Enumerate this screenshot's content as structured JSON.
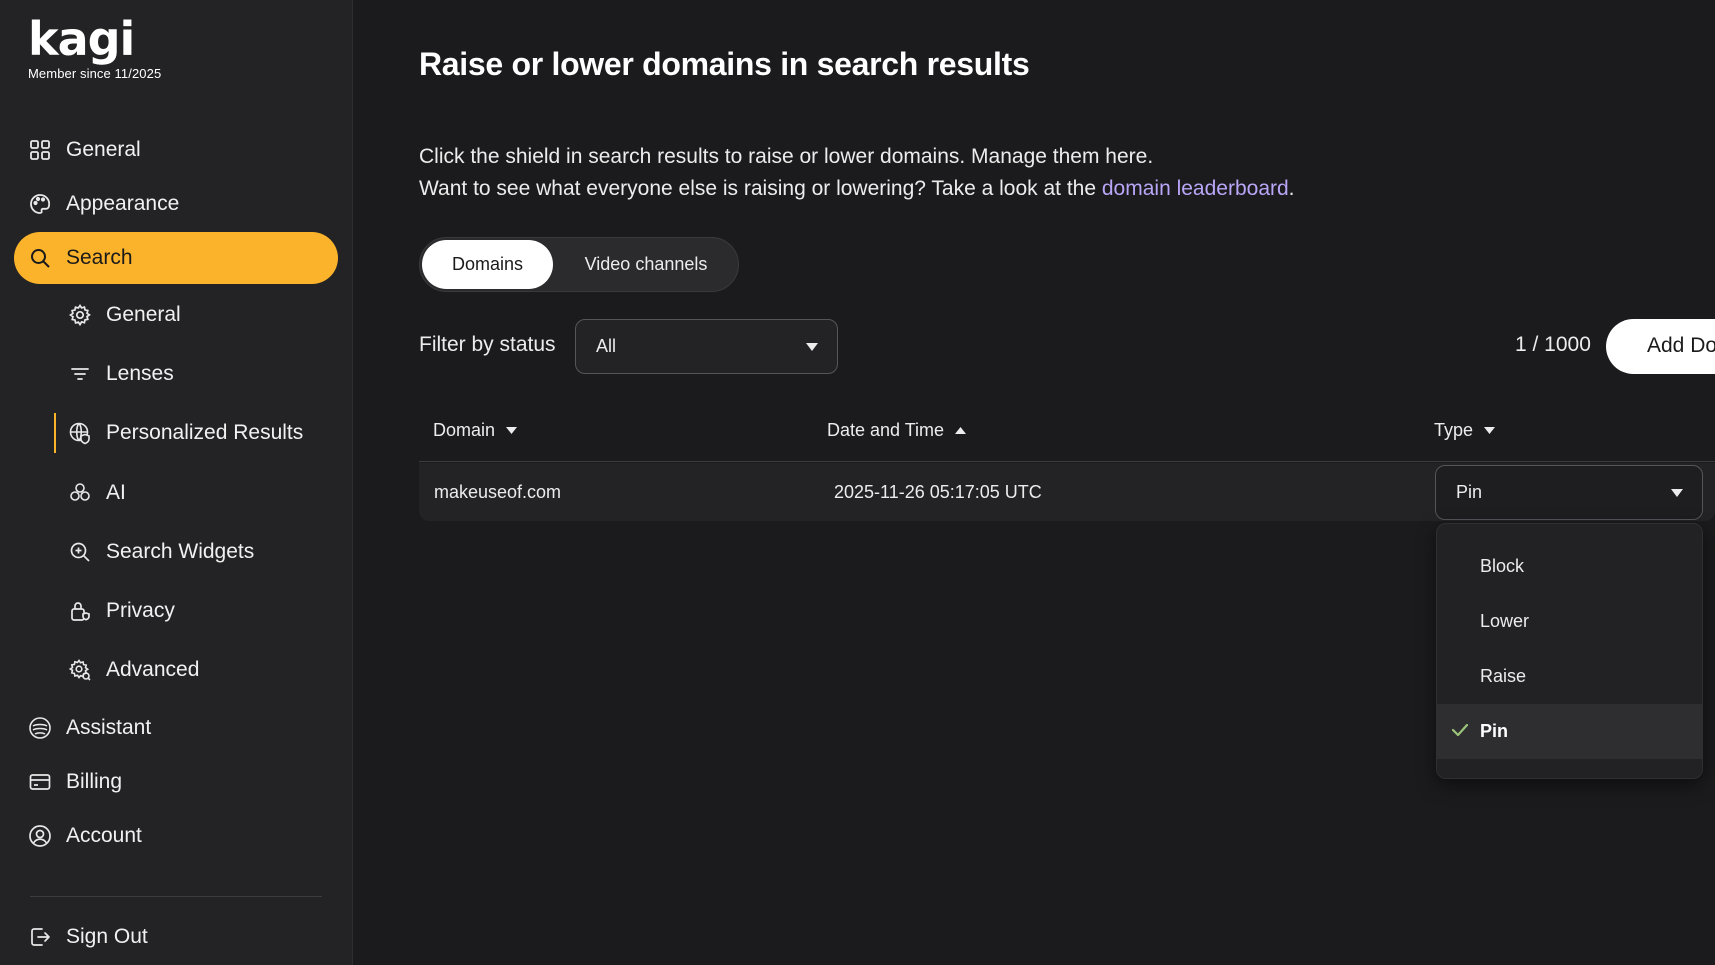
{
  "brand": {
    "name": "kagi",
    "member_since": "Member since 11/2025"
  },
  "sidebar": {
    "items": [
      {
        "label": "General",
        "icon": "grid-icon"
      },
      {
        "label": "Appearance",
        "icon": "palette-icon"
      },
      {
        "label": "Search",
        "icon": "search-icon",
        "active": true
      },
      {
        "label": "Assistant",
        "icon": "assistant-icon"
      },
      {
        "label": "Billing",
        "icon": "credit-card-icon"
      },
      {
        "label": "Account",
        "icon": "user-circle-icon"
      }
    ],
    "sub_items": [
      {
        "label": "General",
        "icon": "gear-icon"
      },
      {
        "label": "Lenses",
        "icon": "filter-icon"
      },
      {
        "label": "Personalized Results",
        "icon": "globe-shield-icon",
        "active": true
      },
      {
        "label": "AI",
        "icon": "ai-icon"
      },
      {
        "label": "Search Widgets",
        "icon": "search-widget-icon"
      },
      {
        "label": "Privacy",
        "icon": "privacy-lock-icon"
      },
      {
        "label": "Advanced",
        "icon": "advanced-gear-icon"
      }
    ],
    "sign_out": "Sign Out"
  },
  "main": {
    "title": "Raise or lower domains in search results",
    "description_line1": "Click the shield in search results to raise or lower domains. Manage them here.",
    "description_line2_prefix": "Want to see what everyone else is raising or lowering? Take a look at the ",
    "leaderboard_link": "domain leaderboard",
    "description_line2_suffix": ".",
    "tabs": [
      {
        "label": "Domains",
        "selected": true
      },
      {
        "label": "Video channels",
        "selected": false
      }
    ],
    "filter": {
      "label": "Filter by status",
      "value": "All"
    },
    "count": "1 / 1000",
    "add_button": "Add Domain",
    "table": {
      "columns": [
        {
          "label": "Domain",
          "sort": "desc"
        },
        {
          "label": "Date and Time",
          "sort": "asc"
        },
        {
          "label": "Type",
          "sort": "desc"
        }
      ],
      "rows": [
        {
          "domain": "makeuseof.com",
          "datetime": "2025-11-26 05:17:05 UTC",
          "type": "Pin"
        }
      ]
    },
    "type_dropdown": {
      "options": [
        "Block",
        "Lower",
        "Raise",
        "Pin"
      ],
      "selected": "Pin"
    }
  },
  "colors": {
    "accent": "#fbb32b",
    "link": "#b9a6f7",
    "background": "#1b1b1d",
    "sidebar": "#232325"
  }
}
